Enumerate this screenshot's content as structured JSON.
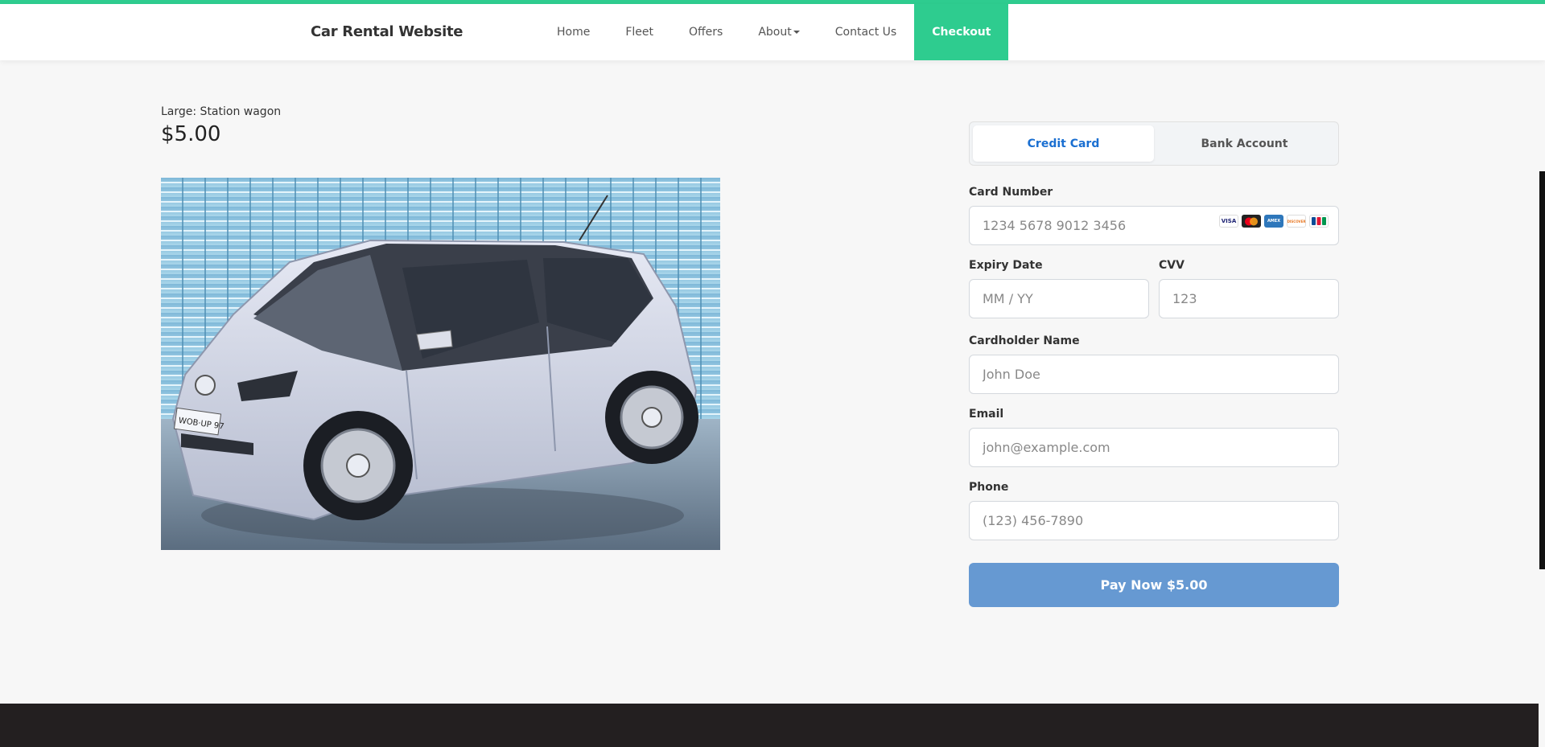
{
  "header": {
    "brand": "Car Rental Website",
    "nav": [
      "Home",
      "Fleet",
      "Offers",
      "About",
      "Contact Us",
      "Checkout"
    ],
    "accent_color": "#2ecc8f"
  },
  "vehicle": {
    "type_label": "Large: Station wagon",
    "price": "$5.00",
    "plate_text": "WOB·UP 97"
  },
  "payment": {
    "tabs": [
      "Credit Card",
      "Bank Account"
    ],
    "card_number": {
      "label": "Card Number",
      "placeholder": "1234 5678 9012 3456"
    },
    "card_logos": [
      "VISA",
      "MC",
      "AMEX",
      "DISCOVER",
      "JCB"
    ],
    "expiry": {
      "label": "Expiry Date",
      "placeholder": "MM / YY"
    },
    "cvv": {
      "label": "CVV",
      "placeholder": "123"
    },
    "cardholder": {
      "label": "Cardholder Name",
      "placeholder": "John Doe"
    },
    "email": {
      "label": "Email",
      "placeholder": "john@example.com"
    },
    "phone": {
      "label": "Phone",
      "placeholder": "(123) 456-7890"
    },
    "pay_button": "Pay Now $5.00",
    "button_color": "#6699d2"
  }
}
